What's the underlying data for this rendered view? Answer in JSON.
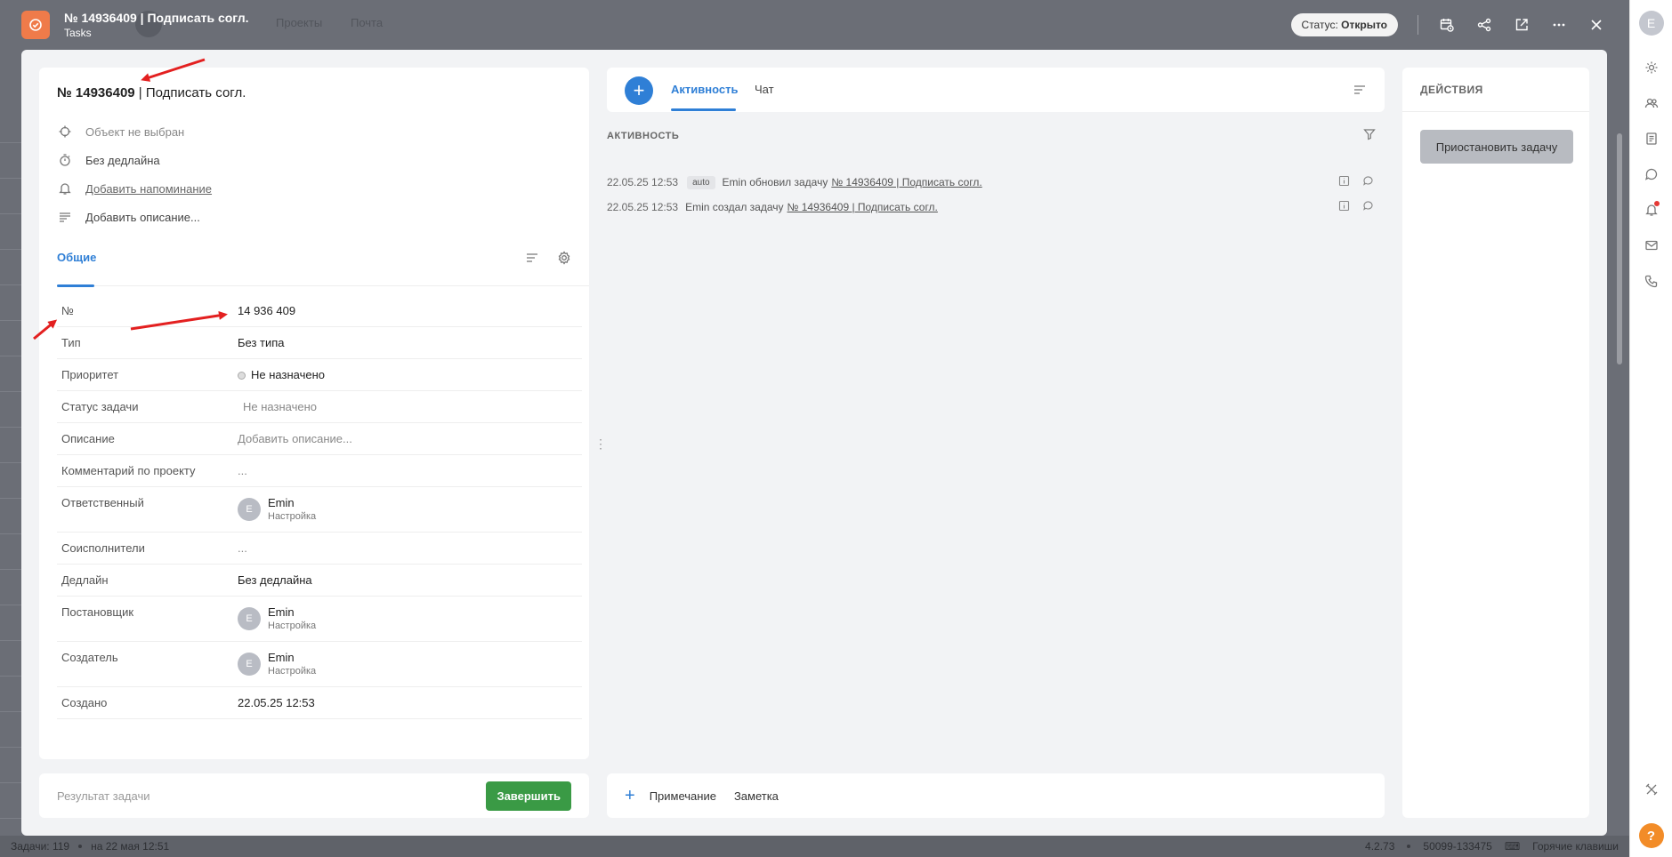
{
  "window": {
    "title": "№ 14936409 | Подписать согл.",
    "subtitle": "Tasks",
    "status_label": "Статус:",
    "status_value": "Открыто",
    "bg_tab_1": "Проекты",
    "bg_tab_2": "Почта"
  },
  "task": {
    "number_prefix": "№ 14936409",
    "name_suffix": " | Подписать согл.",
    "meta": {
      "object": "Объект не выбран",
      "deadline": "Без дедлайна",
      "reminder": "Добавить напоминание",
      "description": "Добавить описание..."
    }
  },
  "tabs_left": {
    "general": "Общие"
  },
  "fields": [
    {
      "label": "№",
      "value": "14 936 409"
    },
    {
      "label": "Тип",
      "value": "Без типа"
    },
    {
      "label": "Приоритет",
      "value": "Не назначено"
    },
    {
      "label": "Статус задачи",
      "value": "Не назначено"
    },
    {
      "label": "Описание",
      "value": "Добавить описание..."
    },
    {
      "label": "Комментарий по проекту",
      "value": "..."
    },
    {
      "label": "Ответственный",
      "value": "Emin",
      "role": "Настройка"
    },
    {
      "label": "Соисполнители",
      "value": "..."
    },
    {
      "label": "Дедлайн",
      "value": "Без дедлайна"
    },
    {
      "label": "Постановщик",
      "value": "Emin",
      "role": "Настройка"
    },
    {
      "label": "Создатель",
      "value": "Emin",
      "role": "Настройка"
    },
    {
      "label": "Создано",
      "value": "22.05.25 12:53"
    }
  ],
  "result_bar": {
    "placeholder": "Результат задачи",
    "finish": "Завершить"
  },
  "center": {
    "tab_activity": "Активность",
    "tab_chat": "Чат",
    "section_title": "АКТИВНОСТЬ",
    "events": [
      {
        "time": "22.05.25 12:53",
        "badge": "auto",
        "text": "Emin обновил задачу",
        "link": "№ 14936409 | Подписать согл."
      },
      {
        "time": "22.05.25 12:53",
        "badge": "",
        "text": "Emin создал задачу",
        "link": "№ 14936409 | Подписать согл."
      }
    ],
    "note_label": "Примечание",
    "memo_label": "Заметка"
  },
  "actions": {
    "title": "ДЕЙСТВИЯ",
    "pause": "Приостановить задачу"
  },
  "rail": {
    "avatar_letter": "E"
  },
  "statusbar": {
    "tasks_count": "Задачи: 119",
    "date": "на 22 мая 12:51",
    "version": "4.2.73",
    "code": "50099-133475",
    "hotkeys": "Горячие клавиши"
  },
  "person_initial": "E",
  "colors": {
    "accent": "#2f7fd6",
    "finish": "#3a9a45",
    "app_icon": "#ef7b4a",
    "annotation": "#e32020"
  }
}
